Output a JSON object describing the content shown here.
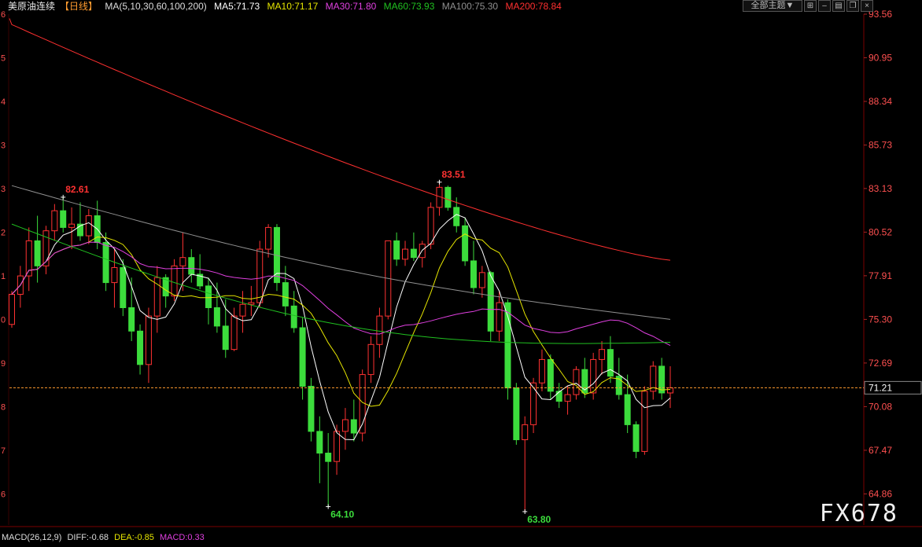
{
  "header": {
    "symbol": "美原油连续",
    "period": "【日线】",
    "ma_params": "MA(5,10,30,60,100,200)",
    "ma5": "MA5:71.73",
    "ma10": "MA10:71.17",
    "ma30": "MA30:71.80",
    "ma60": "MA60:73.93",
    "ma100": "MA100:75.30",
    "ma200": "MA200:78.84"
  },
  "toolbar": {
    "theme_label": "全部主题",
    "theme_arrow": "▼"
  },
  "price_axis": [
    "93.56",
    "90.95",
    "88.34",
    "85.73",
    "83.13",
    "80.52",
    "77.91",
    "75.30",
    "72.69",
    "70.08",
    "67.47",
    "64.86"
  ],
  "left_axis_stubs": [
    "6",
    "5",
    "4",
    "3",
    "3",
    "2",
    "1",
    "0",
    "9",
    "8",
    "7",
    "6"
  ],
  "current_price": "71.21",
  "annotations": {
    "high1": "82.61",
    "high2": "83.51",
    "low1": "64.10",
    "low2": "63.80"
  },
  "macd": {
    "label": "MACD(26,12,9)",
    "diff": "DIFF:-0.68",
    "dea": "DEA:-0.85",
    "macd": "MACD:0.33"
  },
  "watermark": "FX678",
  "colors": {
    "up": "#ff3232",
    "down": "#3cdc3c",
    "ma5": "#ffffff",
    "ma10": "#e6e600",
    "ma30": "#e040e0",
    "ma60": "#20c020",
    "ma100": "#909090",
    "ma200": "#ff3030",
    "price": "#ff5050"
  },
  "chart_data": {
    "type": "candlestick",
    "ylim": [
      63.5,
      93.56
    ],
    "candles": [
      [
        75.0,
        77.0,
        74.8,
        76.8
      ],
      [
        76.8,
        78.5,
        76.0,
        77.9
      ],
      [
        77.9,
        80.8,
        77.0,
        80.0
      ],
      [
        80.0,
        81.5,
        77.5,
        78.5
      ],
      [
        78.5,
        80.9,
        78.0,
        80.6
      ],
      [
        80.6,
        82.2,
        80.0,
        81.8
      ],
      [
        81.8,
        82.61,
        80.5,
        80.8
      ],
      [
        80.8,
        82.0,
        79.5,
        81.0
      ],
      [
        81.0,
        82.3,
        80.0,
        80.3
      ],
      [
        80.3,
        81.9,
        79.8,
        81.5
      ],
      [
        81.5,
        82.4,
        79.5,
        79.9
      ],
      [
        79.9,
        80.5,
        77.0,
        77.5
      ],
      [
        77.5,
        79.5,
        76.0,
        78.4
      ],
      [
        78.4,
        78.9,
        75.5,
        76.0
      ],
      [
        76.0,
        77.8,
        74.0,
        74.6
      ],
      [
        74.6,
        75.0,
        72.0,
        72.6
      ],
      [
        72.6,
        76.0,
        71.5,
        75.5
      ],
      [
        75.5,
        78.5,
        74.5,
        77.8
      ],
      [
        77.8,
        78.0,
        76.0,
        76.7
      ],
      [
        76.7,
        78.9,
        76.4,
        78.5
      ],
      [
        78.5,
        80.5,
        77.0,
        79.0
      ],
      [
        79.0,
        79.5,
        77.5,
        78.0
      ],
      [
        78.0,
        79.2,
        77.1,
        77.3
      ],
      [
        77.3,
        77.8,
        75.0,
        76.0
      ],
      [
        76.0,
        77.5,
        74.5,
        74.9
      ],
      [
        74.9,
        76.5,
        73.0,
        73.5
      ],
      [
        73.5,
        76.0,
        73.4,
        75.5
      ],
      [
        75.5,
        77.0,
        74.5,
        76.2
      ],
      [
        76.2,
        77.3,
        75.5,
        76.3
      ],
      [
        76.3,
        80.0,
        76.0,
        79.5
      ],
      [
        79.5,
        81.0,
        79.0,
        80.8
      ],
      [
        80.8,
        81.0,
        77.0,
        77.5
      ],
      [
        77.5,
        78.5,
        75.5,
        76.1
      ],
      [
        76.1,
        77.0,
        74.5,
        74.8
      ],
      [
        74.8,
        75.4,
        70.5,
        71.3
      ],
      [
        71.3,
        71.8,
        68.0,
        68.6
      ],
      [
        68.6,
        69.5,
        65.5,
        67.3
      ],
      [
        67.3,
        68.5,
        64.1,
        66.8
      ],
      [
        66.8,
        69.0,
        66.0,
        68.6
      ],
      [
        68.6,
        70.0,
        67.5,
        69.3
      ],
      [
        69.3,
        70.5,
        68.0,
        68.5
      ],
      [
        68.5,
        72.3,
        68.0,
        72.0
      ],
      [
        72.0,
        74.3,
        71.5,
        73.8
      ],
      [
        73.8,
        76.0,
        73.0,
        75.5
      ],
      [
        75.5,
        80.0,
        75.3,
        80.0
      ],
      [
        80.0,
        80.5,
        78.5,
        78.9
      ],
      [
        78.9,
        80.0,
        78.5,
        79.5
      ],
      [
        79.5,
        80.5,
        78.8,
        79.0
      ],
      [
        79.0,
        80.0,
        78.4,
        79.8
      ],
      [
        79.8,
        82.3,
        79.5,
        82.0
      ],
      [
        82.0,
        83.51,
        81.5,
        83.2
      ],
      [
        83.2,
        83.3,
        81.8,
        82.0
      ],
      [
        82.0,
        82.6,
        80.5,
        80.9
      ],
      [
        80.9,
        81.4,
        78.5,
        78.8
      ],
      [
        78.8,
        80.0,
        76.8,
        77.2
      ],
      [
        77.2,
        78.5,
        76.6,
        78.1
      ],
      [
        78.1,
        78.2,
        74.0,
        74.6
      ],
      [
        74.6,
        77.0,
        74.0,
        76.3
      ],
      [
        76.3,
        76.5,
        70.5,
        71.2
      ],
      [
        71.2,
        71.5,
        67.8,
        68.1
      ],
      [
        68.1,
        69.5,
        63.8,
        69.0
      ],
      [
        69.0,
        71.8,
        68.5,
        71.5
      ],
      [
        71.5,
        73.5,
        71.0,
        72.9
      ],
      [
        72.9,
        73.2,
        70.5,
        71.0
      ],
      [
        71.0,
        71.5,
        70.0,
        70.4
      ],
      [
        70.4,
        71.3,
        69.6,
        70.8
      ],
      [
        70.8,
        72.5,
        70.5,
        72.3
      ],
      [
        72.3,
        73.0,
        70.6,
        70.9
      ],
      [
        70.9,
        73.3,
        70.5,
        72.9
      ],
      [
        72.9,
        74.0,
        72.0,
        73.5
      ],
      [
        73.5,
        74.3,
        71.5,
        71.9
      ],
      [
        71.9,
        73.0,
        70.5,
        70.8
      ],
      [
        70.8,
        72.0,
        68.5,
        69.0
      ],
      [
        69.0,
        69.2,
        67.0,
        67.4
      ],
      [
        67.4,
        71.3,
        67.2,
        71.0
      ],
      [
        71.0,
        72.8,
        70.5,
        72.5
      ],
      [
        72.5,
        73.0,
        70.5,
        70.9
      ],
      [
        70.9,
        72.5,
        70.0,
        71.2
      ]
    ]
  }
}
